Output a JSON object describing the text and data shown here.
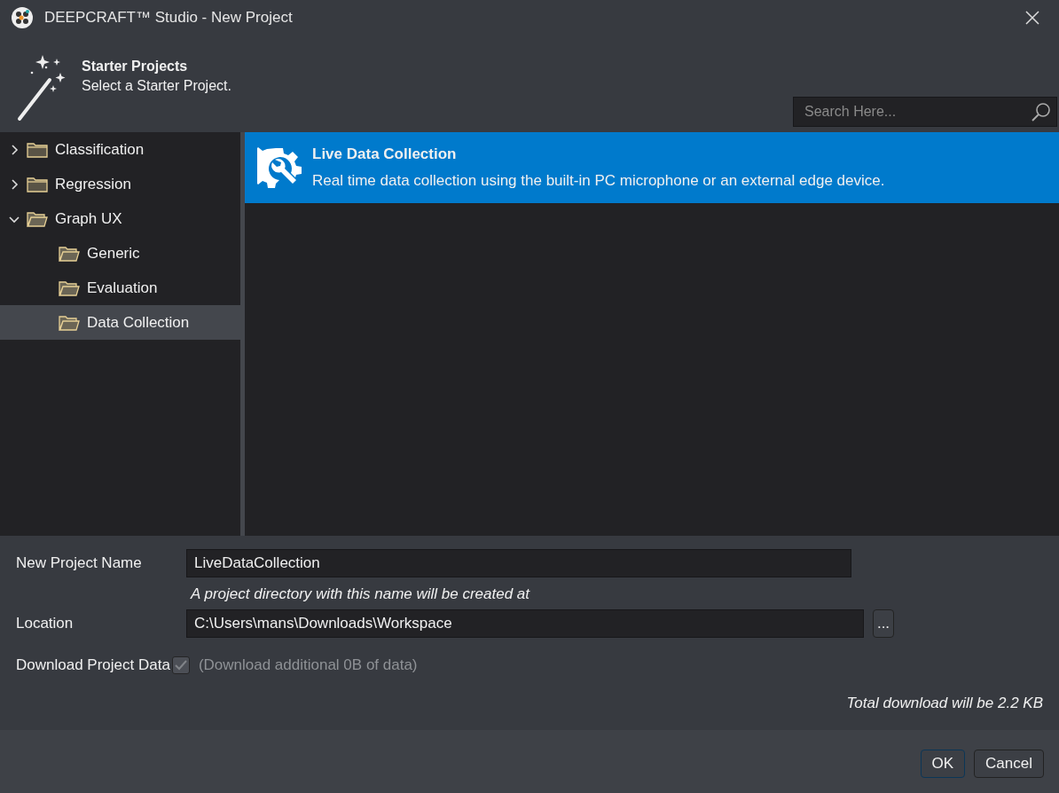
{
  "window": {
    "title": "DEEPCRAFT™ Studio - New Project"
  },
  "header": {
    "title": "Starter Projects",
    "subtitle": "Select a Starter Project."
  },
  "search": {
    "placeholder": "Search Here..."
  },
  "tree": [
    {
      "label": "Classification",
      "expanded": false,
      "selected": false
    },
    {
      "label": "Regression",
      "expanded": false,
      "selected": false
    },
    {
      "label": "Graph UX",
      "expanded": true,
      "selected": false,
      "children": [
        {
          "label": "Generic",
          "selected": false
        },
        {
          "label": "Evaluation",
          "selected": false
        },
        {
          "label": "Data Collection",
          "selected": true
        }
      ]
    }
  ],
  "projects": [
    {
      "title": "Live Data Collection",
      "description": "Real time data collection using the built-in PC microphone or an external edge device.",
      "selected": true
    }
  ],
  "form": {
    "name_label": "New Project Name",
    "name_value": "LiveDataCollection",
    "hint": "A project directory with this name will be created at",
    "location_label": "Location",
    "location_value": "C:\\Users\\mans\\Downloads\\Workspace",
    "browse_button": "...",
    "download_label": "Download Project Data",
    "download_checked": true,
    "download_disabled": true,
    "download_note": "(Download additional 0B of data)",
    "total": "Total download will be 2.2 KB"
  },
  "buttons": [
    "OK",
    "Cancel"
  ]
}
